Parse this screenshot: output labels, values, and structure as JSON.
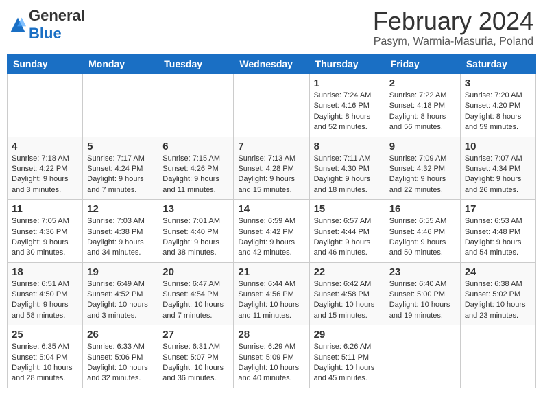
{
  "header": {
    "logo_general": "General",
    "logo_blue": "Blue",
    "title": "February 2024",
    "subtitle": "Pasym, Warmia-Masuria, Poland"
  },
  "days_of_week": [
    "Sunday",
    "Monday",
    "Tuesday",
    "Wednesday",
    "Thursday",
    "Friday",
    "Saturday"
  ],
  "weeks": [
    [
      {
        "day": "",
        "info": ""
      },
      {
        "day": "",
        "info": ""
      },
      {
        "day": "",
        "info": ""
      },
      {
        "day": "",
        "info": ""
      },
      {
        "day": "1",
        "info": "Sunrise: 7:24 AM\nSunset: 4:16 PM\nDaylight: 8 hours\nand 52 minutes."
      },
      {
        "day": "2",
        "info": "Sunrise: 7:22 AM\nSunset: 4:18 PM\nDaylight: 8 hours\nand 56 minutes."
      },
      {
        "day": "3",
        "info": "Sunrise: 7:20 AM\nSunset: 4:20 PM\nDaylight: 8 hours\nand 59 minutes."
      }
    ],
    [
      {
        "day": "4",
        "info": "Sunrise: 7:18 AM\nSunset: 4:22 PM\nDaylight: 9 hours\nand 3 minutes."
      },
      {
        "day": "5",
        "info": "Sunrise: 7:17 AM\nSunset: 4:24 PM\nDaylight: 9 hours\nand 7 minutes."
      },
      {
        "day": "6",
        "info": "Sunrise: 7:15 AM\nSunset: 4:26 PM\nDaylight: 9 hours\nand 11 minutes."
      },
      {
        "day": "7",
        "info": "Sunrise: 7:13 AM\nSunset: 4:28 PM\nDaylight: 9 hours\nand 15 minutes."
      },
      {
        "day": "8",
        "info": "Sunrise: 7:11 AM\nSunset: 4:30 PM\nDaylight: 9 hours\nand 18 minutes."
      },
      {
        "day": "9",
        "info": "Sunrise: 7:09 AM\nSunset: 4:32 PM\nDaylight: 9 hours\nand 22 minutes."
      },
      {
        "day": "10",
        "info": "Sunrise: 7:07 AM\nSunset: 4:34 PM\nDaylight: 9 hours\nand 26 minutes."
      }
    ],
    [
      {
        "day": "11",
        "info": "Sunrise: 7:05 AM\nSunset: 4:36 PM\nDaylight: 9 hours\nand 30 minutes."
      },
      {
        "day": "12",
        "info": "Sunrise: 7:03 AM\nSunset: 4:38 PM\nDaylight: 9 hours\nand 34 minutes."
      },
      {
        "day": "13",
        "info": "Sunrise: 7:01 AM\nSunset: 4:40 PM\nDaylight: 9 hours\nand 38 minutes."
      },
      {
        "day": "14",
        "info": "Sunrise: 6:59 AM\nSunset: 4:42 PM\nDaylight: 9 hours\nand 42 minutes."
      },
      {
        "day": "15",
        "info": "Sunrise: 6:57 AM\nSunset: 4:44 PM\nDaylight: 9 hours\nand 46 minutes."
      },
      {
        "day": "16",
        "info": "Sunrise: 6:55 AM\nSunset: 4:46 PM\nDaylight: 9 hours\nand 50 minutes."
      },
      {
        "day": "17",
        "info": "Sunrise: 6:53 AM\nSunset: 4:48 PM\nDaylight: 9 hours\nand 54 minutes."
      }
    ],
    [
      {
        "day": "18",
        "info": "Sunrise: 6:51 AM\nSunset: 4:50 PM\nDaylight: 9 hours\nand 58 minutes."
      },
      {
        "day": "19",
        "info": "Sunrise: 6:49 AM\nSunset: 4:52 PM\nDaylight: 10 hours\nand 3 minutes."
      },
      {
        "day": "20",
        "info": "Sunrise: 6:47 AM\nSunset: 4:54 PM\nDaylight: 10 hours\nand 7 minutes."
      },
      {
        "day": "21",
        "info": "Sunrise: 6:44 AM\nSunset: 4:56 PM\nDaylight: 10 hours\nand 11 minutes."
      },
      {
        "day": "22",
        "info": "Sunrise: 6:42 AM\nSunset: 4:58 PM\nDaylight: 10 hours\nand 15 minutes."
      },
      {
        "day": "23",
        "info": "Sunrise: 6:40 AM\nSunset: 5:00 PM\nDaylight: 10 hours\nand 19 minutes."
      },
      {
        "day": "24",
        "info": "Sunrise: 6:38 AM\nSunset: 5:02 PM\nDaylight: 10 hours\nand 23 minutes."
      }
    ],
    [
      {
        "day": "25",
        "info": "Sunrise: 6:35 AM\nSunset: 5:04 PM\nDaylight: 10 hours\nand 28 minutes."
      },
      {
        "day": "26",
        "info": "Sunrise: 6:33 AM\nSunset: 5:06 PM\nDaylight: 10 hours\nand 32 minutes."
      },
      {
        "day": "27",
        "info": "Sunrise: 6:31 AM\nSunset: 5:07 PM\nDaylight: 10 hours\nand 36 minutes."
      },
      {
        "day": "28",
        "info": "Sunrise: 6:29 AM\nSunset: 5:09 PM\nDaylight: 10 hours\nand 40 minutes."
      },
      {
        "day": "29",
        "info": "Sunrise: 6:26 AM\nSunset: 5:11 PM\nDaylight: 10 hours\nand 45 minutes."
      },
      {
        "day": "",
        "info": ""
      },
      {
        "day": "",
        "info": ""
      }
    ]
  ]
}
